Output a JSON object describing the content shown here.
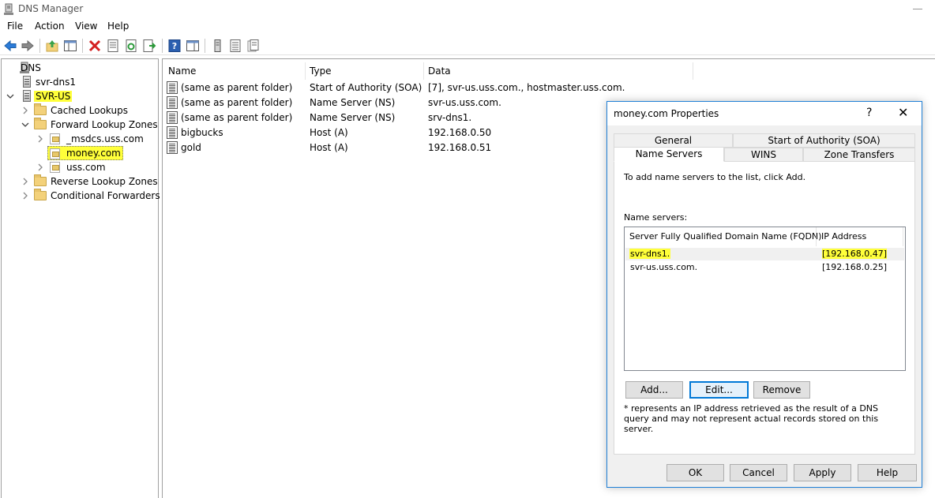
{
  "window": {
    "title": "DNS Manager"
  },
  "menu": [
    "File",
    "Action",
    "View",
    "Help"
  ],
  "toolbar": {
    "icons": [
      "back-arrow-icon",
      "forward-arrow-icon",
      "up-folder-icon",
      "show-hide-tree-icon",
      "delete-icon",
      "properties-icon",
      "refresh-icon",
      "export-list-icon",
      "help-icon",
      "show-hide-action-pane-icon",
      "server-icon",
      "list-view-icon",
      "detail-view-icon"
    ]
  },
  "tree": {
    "root": "DNS",
    "server1": "svr-dns1",
    "server2": "SVR-US",
    "cached": "Cached Lookups",
    "forward": "Forward Lookup Zones",
    "msdcs": "_msdcs.uss.com",
    "money": "money.com",
    "uss": "uss.com",
    "reverse": "Reverse Lookup Zones",
    "conditional": "Conditional Forwarders"
  },
  "list": {
    "columns": [
      "Name",
      "Type",
      "Data"
    ],
    "rows": [
      {
        "name": "(same as parent folder)",
        "type": "Start of Authority (SOA)",
        "data": "[7], svr-us.uss.com., hostmaster.uss.com."
      },
      {
        "name": "(same as parent folder)",
        "type": "Name Server (NS)",
        "data": "svr-us.uss.com."
      },
      {
        "name": "(same as parent folder)",
        "type": "Name Server (NS)",
        "data": "srv-dns1."
      },
      {
        "name": "bigbucks",
        "type": "Host (A)",
        "data": "192.168.0.50"
      },
      {
        "name": "gold",
        "type": "Host (A)",
        "data": "192.168.0.51"
      }
    ]
  },
  "dialog": {
    "title": "money.com Properties",
    "help": "?",
    "close": "✕",
    "tabs": {
      "general": "General",
      "soa": "Start of Authority (SOA)",
      "name_servers": "Name Servers",
      "wins": "WINS",
      "zone_transfers": "Zone Transfers"
    },
    "instructions": "To add name servers to the list, click Add.",
    "ns_label": "Name servers:",
    "ns_columns": [
      "Server Fully Qualified Domain Name (FQDN)",
      "IP Address"
    ],
    "ns_rows": [
      {
        "fqdn": "svr-dns1.",
        "ip": "[192.168.0.47]"
      },
      {
        "fqdn": "svr-us.uss.com.",
        "ip": "[192.168.0.25]"
      }
    ],
    "add": "Add...",
    "edit": "Edit...",
    "remove": "Remove",
    "note": "* represents an IP address retrieved as the result of a DNS query and may not represent actual records stored on this server.",
    "ok": "OK",
    "cancel": "Cancel",
    "apply": "Apply",
    "help_btn": "Help"
  },
  "colors": {
    "highlight": "#ffff3a",
    "dialog_border": "#1f7fd6",
    "focus": "#0078d7"
  }
}
